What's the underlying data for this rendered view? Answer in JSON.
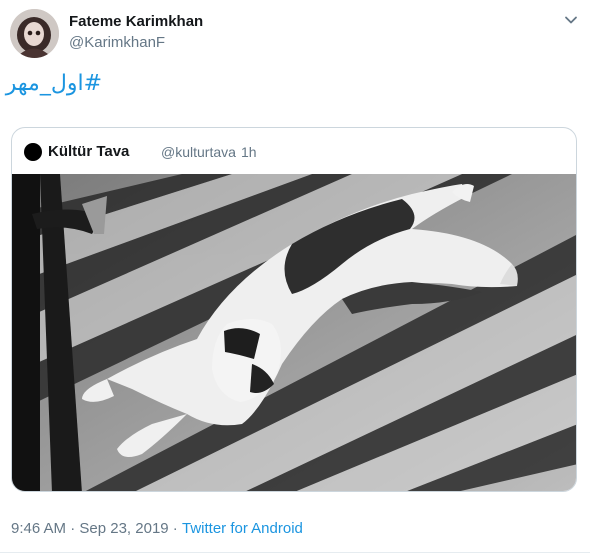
{
  "tweet": {
    "author_name": "Fateme Karimkhan",
    "author_handle": "@KarimkhanF",
    "text": "#اول_مهر"
  },
  "quote": {
    "author_name": "Kültür Tava",
    "author_handle": "@kulturtava",
    "separator": "·",
    "time": "1h"
  },
  "footer": {
    "time": "9:46 AM",
    "sep1": " · ",
    "date": "Sep 23, 2019",
    "sep2": " · ",
    "app": "Twitter for Android"
  },
  "icons": {
    "menu": "chevron-down-icon"
  },
  "colors": {
    "link": "#1b95e0",
    "muted": "#657786",
    "border": "#ccd6dd"
  }
}
